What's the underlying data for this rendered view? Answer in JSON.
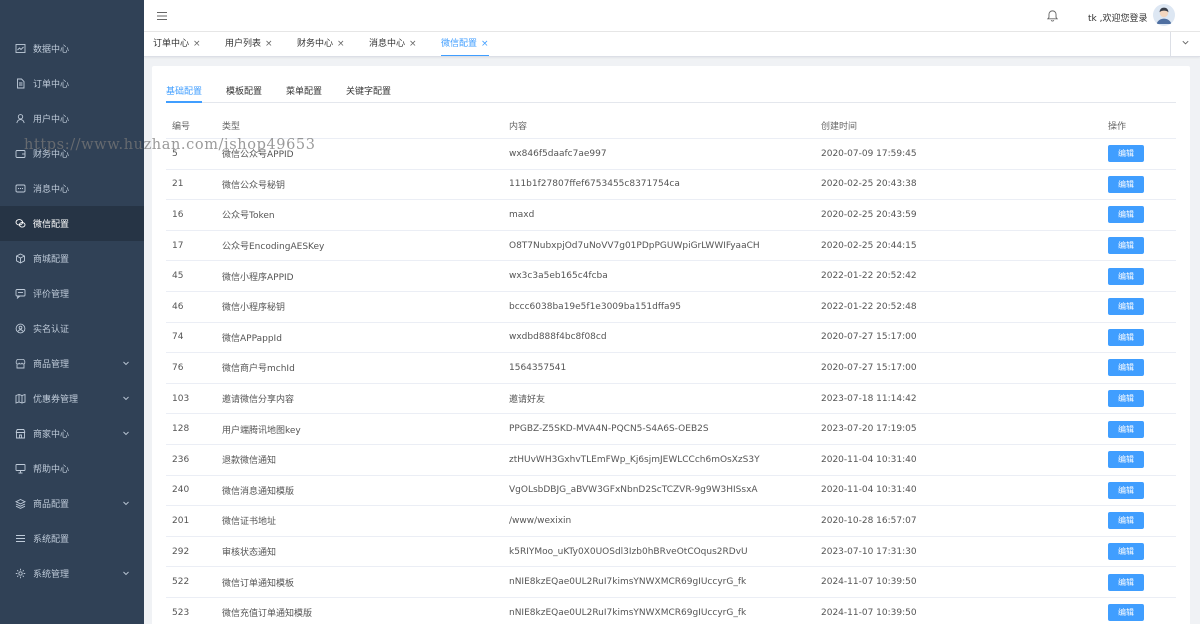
{
  "sidebar": {
    "items": [
      {
        "label": "数据中心",
        "icon": "chart-line-icon",
        "has_submenu": false,
        "active": false
      },
      {
        "label": "订单中心",
        "icon": "document-icon",
        "has_submenu": false,
        "active": false
      },
      {
        "label": "用户中心",
        "icon": "user-icon",
        "has_submenu": false,
        "active": false
      },
      {
        "label": "财务中心",
        "icon": "wallet-icon",
        "has_submenu": false,
        "active": false
      },
      {
        "label": "消息中心",
        "icon": "chat-dots-icon",
        "has_submenu": false,
        "active": false
      },
      {
        "label": "微信配置",
        "icon": "wechat-icon",
        "has_submenu": false,
        "active": true
      },
      {
        "label": "商城配置",
        "icon": "cube-icon",
        "has_submenu": false,
        "active": false
      },
      {
        "label": "评价管理",
        "icon": "comment-icon",
        "has_submenu": false,
        "active": false
      },
      {
        "label": "实名认证",
        "icon": "id-badge-icon",
        "has_submenu": false,
        "active": false
      },
      {
        "label": "商品管理",
        "icon": "store-icon",
        "has_submenu": true,
        "active": false
      },
      {
        "label": "优惠券管理",
        "icon": "map-icon",
        "has_submenu": true,
        "active": false
      },
      {
        "label": "商家中心",
        "icon": "shop-icon",
        "has_submenu": true,
        "active": false
      },
      {
        "label": "帮助中心",
        "icon": "monitor-icon",
        "has_submenu": false,
        "active": false
      },
      {
        "label": "商品配置",
        "icon": "layers-icon",
        "has_submenu": true,
        "active": false
      },
      {
        "label": "系统配置",
        "icon": "menu-lines-icon",
        "has_submenu": false,
        "active": false
      },
      {
        "label": "系统管理",
        "icon": "gear-icon",
        "has_submenu": true,
        "active": false
      }
    ]
  },
  "header": {
    "welcome": "tk ,欢迎您登录"
  },
  "tabs": [
    {
      "label": "订单中心",
      "active": false
    },
    {
      "label": "用户列表",
      "active": false
    },
    {
      "label": "财务中心",
      "active": false
    },
    {
      "label": "消息中心",
      "active": false
    },
    {
      "label": "微信配置",
      "active": true
    }
  ],
  "close_glyph": "×",
  "subtabs": [
    {
      "label": "基础配置",
      "active": true
    },
    {
      "label": "模板配置",
      "active": false
    },
    {
      "label": "菜单配置",
      "active": false
    },
    {
      "label": "关键字配置",
      "active": false
    }
  ],
  "table": {
    "columns": [
      "编号",
      "类型",
      "内容",
      "创建时间",
      "操作"
    ],
    "edit_label": "编辑",
    "rows": [
      {
        "id": "5",
        "type": "微信公众号APPID",
        "content": "wx846f5daafc7ae997",
        "created": "2020-07-09 17:59:45"
      },
      {
        "id": "21",
        "type": "微信公众号秘钥",
        "content": "111b1f27807ffef6753455c8371754ca",
        "created": "2020-02-25 20:43:38"
      },
      {
        "id": "16",
        "type": "公众号Token",
        "content": "maxd",
        "created": "2020-02-25 20:43:59"
      },
      {
        "id": "17",
        "type": "公众号EncodingAESKey",
        "content": "O8T7NubxpjOd7uNoVV7g01PDpPGUWpiGrLWWIFyaaCH",
        "created": "2020-02-25 20:44:15"
      },
      {
        "id": "45",
        "type": "微信小程序APPID",
        "content": "wx3c3a5eb165c4fcba",
        "created": "2022-01-22 20:52:42"
      },
      {
        "id": "46",
        "type": "微信小程序秘钥",
        "content": "bccc6038ba19e5f1e3009ba151dffa95",
        "created": "2022-01-22 20:52:48"
      },
      {
        "id": "74",
        "type": "微信APPappId",
        "content": "wxdbd888f4bc8f08cd",
        "created": "2020-07-27 15:17:00"
      },
      {
        "id": "76",
        "type": "微信商户号mchId",
        "content": "1564357541",
        "created": "2020-07-27 15:17:00"
      },
      {
        "id": "103",
        "type": "邀请微信分享内容",
        "content": "邀请好友",
        "created": "2023-07-18 11:14:42"
      },
      {
        "id": "128",
        "type": "用户端腾讯地图key",
        "content": "PPGBZ-Z5SKD-MVA4N-PQCN5-S4A6S-OEB2S",
        "created": "2023-07-20 17:19:05"
      },
      {
        "id": "236",
        "type": "退款微信通知",
        "content": "ztHUvWH3GxhvTLEmFWp_Kj6sjmJEWLCCch6mOsXzS3Y",
        "created": "2020-11-04 10:31:40"
      },
      {
        "id": "240",
        "type": "微信消息通知模版",
        "content": "VgOLsbDBJG_aBVW3GFxNbnD2ScTCZVR-9g9W3HISsxA",
        "created": "2020-11-04 10:31:40"
      },
      {
        "id": "201",
        "type": "微信证书地址",
        "content": "/www/wexixin",
        "created": "2020-10-28 16:57:07"
      },
      {
        "id": "292",
        "type": "审核状态通知",
        "content": "k5RIYMoo_uKTy0X0UOSdl3Izb0hBRveOtCOqus2RDvU",
        "created": "2023-07-10 17:31:30"
      },
      {
        "id": "522",
        "type": "微信订单通知模板",
        "content": "nNIE8kzEQae0UL2RuI7kimsYNWXMCR69gIUccyrG_fk",
        "created": "2024-11-07 10:39:50"
      },
      {
        "id": "523",
        "type": "微信充值订单通知模版",
        "content": "nNIE8kzEQae0UL2RuI7kimsYNWXMCR69gIUccyrG_fk",
        "created": "2024-11-07 10:39:50"
      }
    ]
  },
  "watermark": "https://www.huzhan.com/ishop49653",
  "colors": {
    "sidebar_bg": "#304156",
    "sidebar_active_bg": "#263445",
    "sidebar_text": "#bfcbd9",
    "accent": "#409eff",
    "page_bg": "#f0f2f5"
  }
}
